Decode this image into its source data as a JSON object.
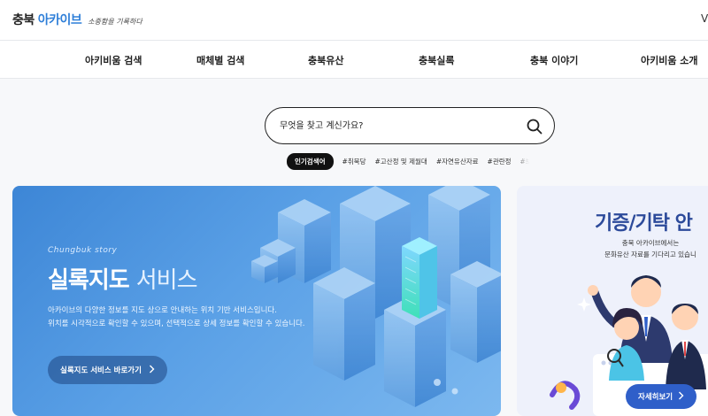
{
  "header": {
    "logo_main": "충북",
    "logo_accent": "아카이브",
    "logo_sub": "소중함을 기록하다",
    "edge_char": "V"
  },
  "gnb": {
    "items": [
      "아키비움 검색",
      "매체별 검색",
      "충북유산",
      "충북실록",
      "충북 이야기",
      "아키비움 소개"
    ]
  },
  "search": {
    "placeholder": "무엇을 찾고 계신가요?"
  },
  "keywords": {
    "badge": "인기검색어",
    "items": [
      "#취묵당",
      "#고산정 및 제월대",
      "#자연유산자료",
      "#관란정",
      "#보"
    ]
  },
  "banner_main": {
    "eyebrow": "Chungbuk story",
    "title_bold": "실록지도",
    "title_light": "서비스",
    "desc_line1": "아카이브의 다양한 정보를 지도 상으로 안내하는 위치 기반 서비스입니다.",
    "desc_line2": "위치를 시각적으로 확인할 수 있으며, 선택적으로 상세 정보를 확인할 수 있습니다.",
    "button_label": "실록지도 서비스 바로가기",
    "button_icon": "chevron-right-icon"
  },
  "banner_side": {
    "title": "기증/기탁 안",
    "desc_line1": "충북 아카이브에서는",
    "desc_line2": "문화유산 자료를 기다리고 있습니",
    "button_label": "자세히보기",
    "button_icon": "chevron-right-icon"
  },
  "colors": {
    "accent": "#2f7fd8",
    "banner_blue": "#4a93de",
    "side_title": "#2c4a9a",
    "side_button": "#2f5fc9"
  }
}
